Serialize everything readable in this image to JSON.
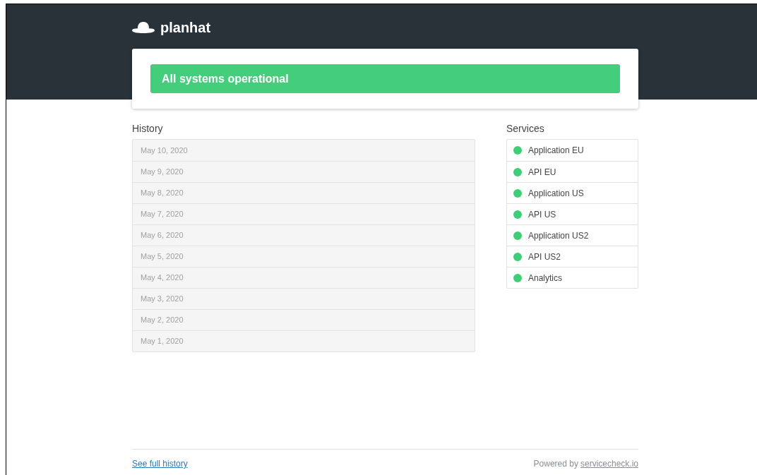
{
  "brand": {
    "name": "planhat"
  },
  "status_banner": {
    "text": "All systems operational",
    "color": "#44ce7c"
  },
  "history": {
    "title": "History",
    "days": [
      {
        "date": "May 10, 2020"
      },
      {
        "date": "May 9, 2020"
      },
      {
        "date": "May 8, 2020"
      },
      {
        "date": "May 7, 2020"
      },
      {
        "date": "May 6, 2020"
      },
      {
        "date": "May 5, 2020"
      },
      {
        "date": "May 4, 2020"
      },
      {
        "date": "May 3, 2020"
      },
      {
        "date": "May 2, 2020"
      },
      {
        "date": "May 1, 2020"
      }
    ]
  },
  "services": {
    "title": "Services",
    "items": [
      {
        "name": "Application EU",
        "color": "#3ecf76"
      },
      {
        "name": "API EU",
        "color": "#3ecf76"
      },
      {
        "name": "Application US",
        "color": "#3ecf76"
      },
      {
        "name": "API US",
        "color": "#3ecf76"
      },
      {
        "name": "Application US2",
        "color": "#3ecf76"
      },
      {
        "name": "API US2",
        "color": "#3ecf76"
      },
      {
        "name": "Analytics",
        "color": "#3ecf76"
      }
    ]
  },
  "footer": {
    "link": "See full history",
    "powered_by": "Powered by",
    "powered_link": "servicecheck.io"
  }
}
